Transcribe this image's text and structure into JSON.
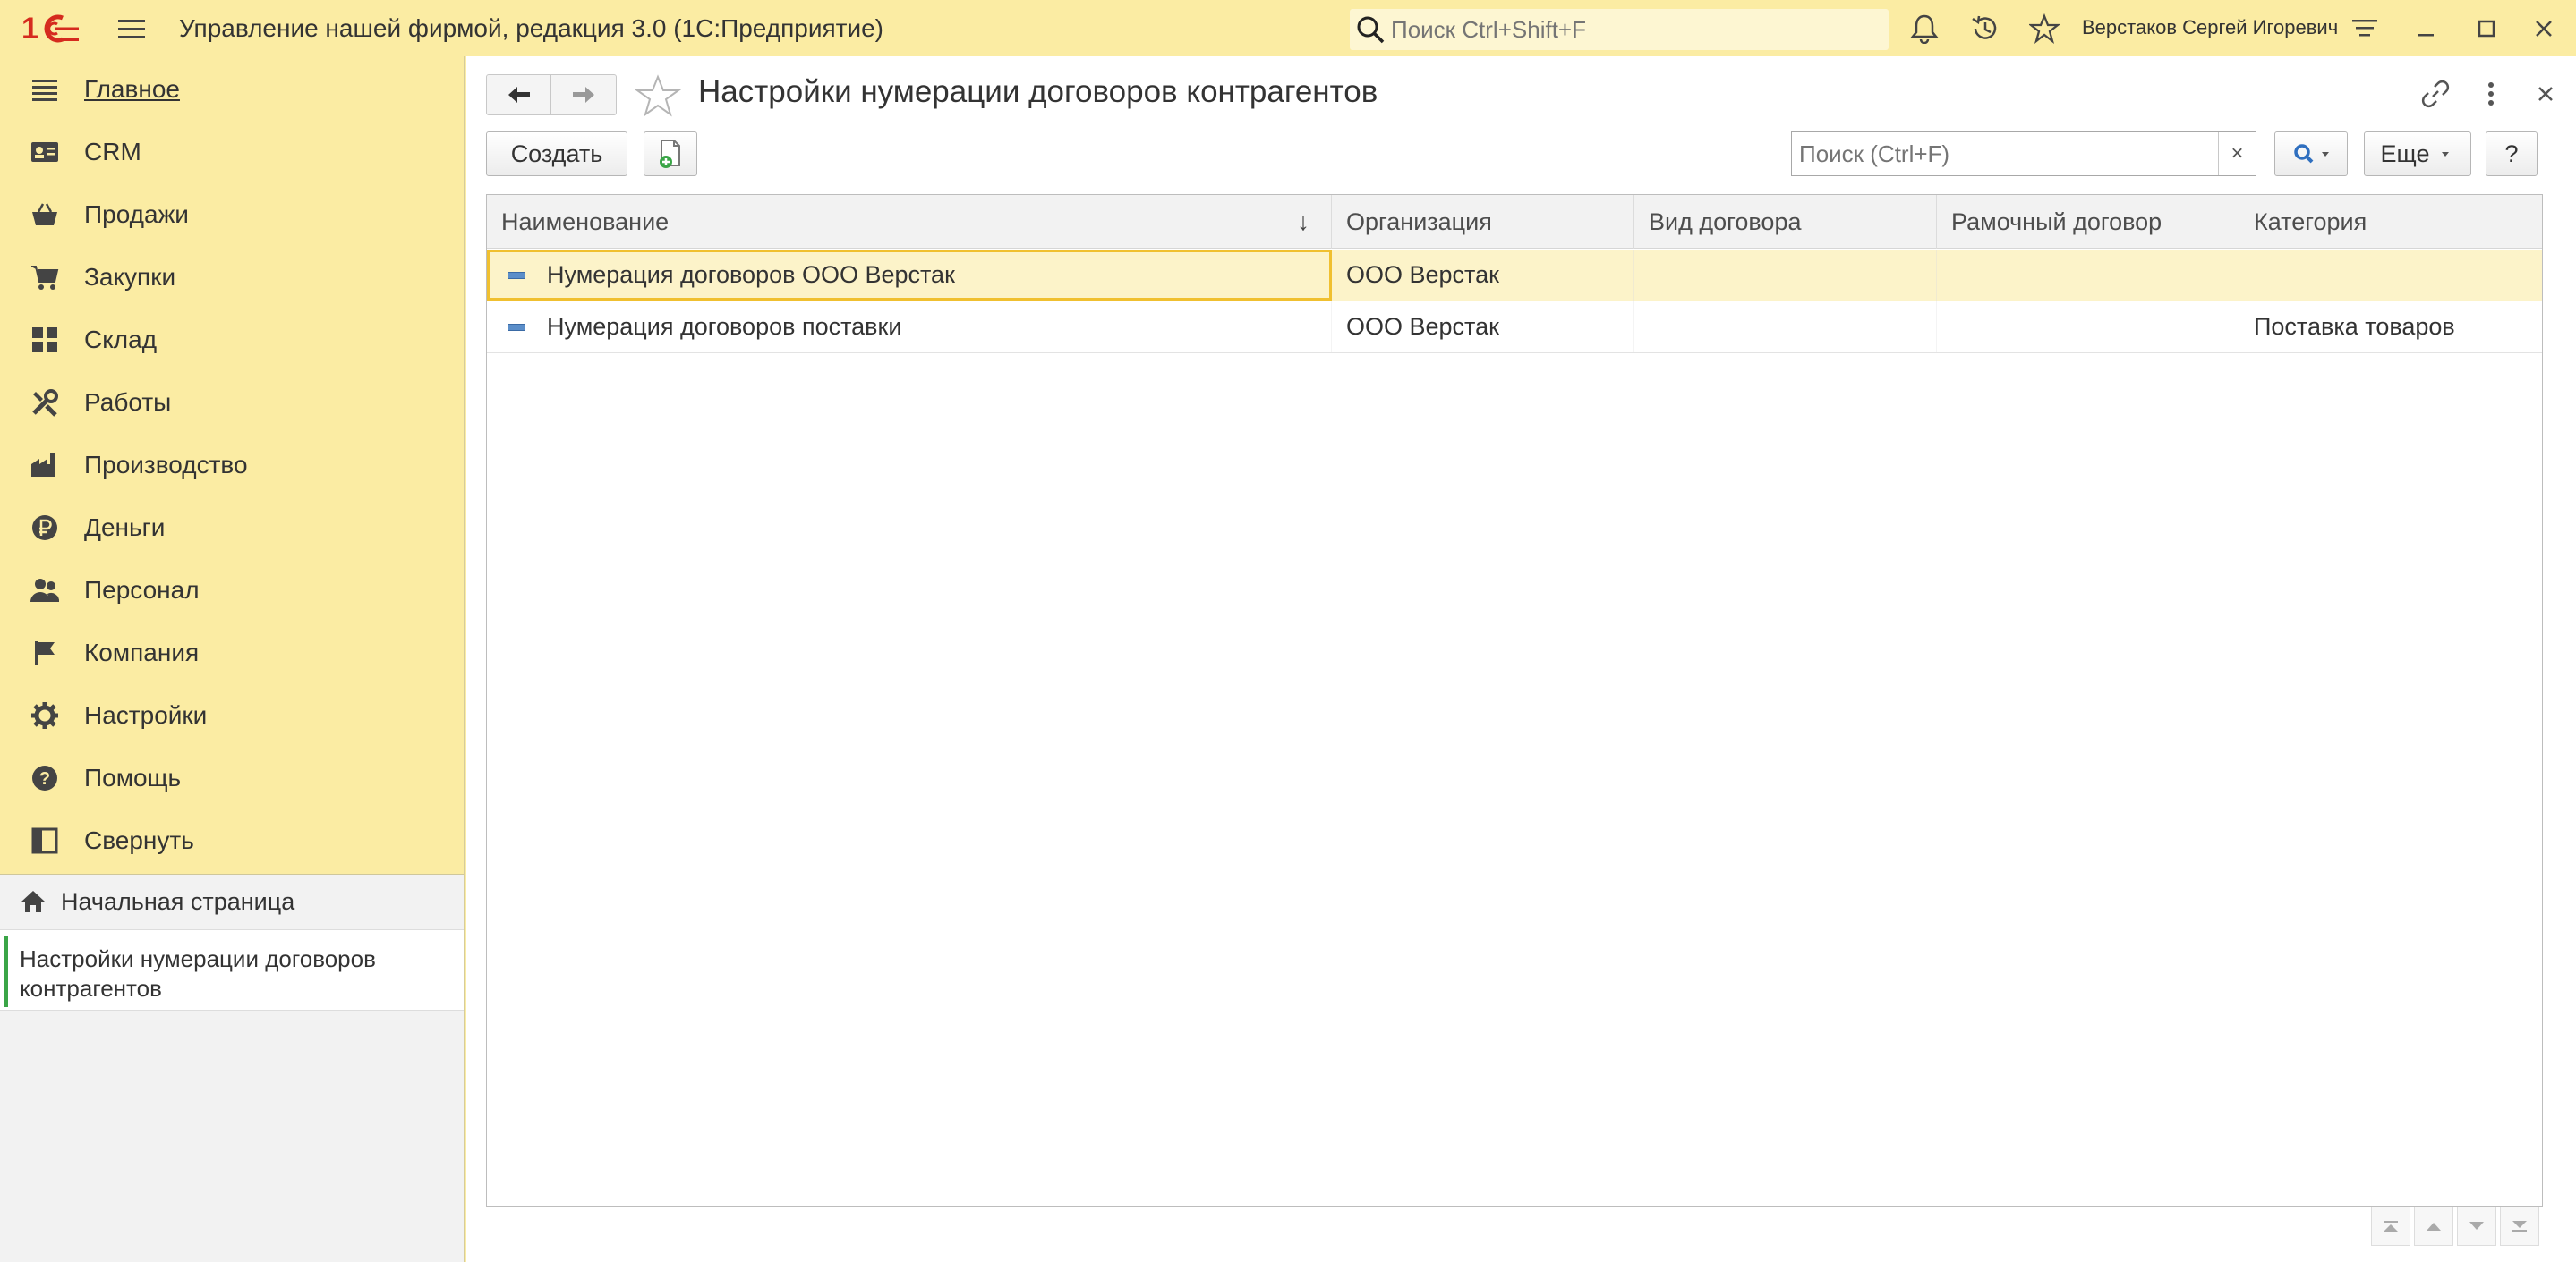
{
  "app": {
    "title": "Управление нашей фирмой, редакция 3.0  (1С:Предприятие)",
    "search_placeholder": "Поиск Ctrl+Shift+F",
    "user": "Верстаков Сергей Игоревич"
  },
  "sidebar": {
    "items": [
      {
        "label": "Главное",
        "icon": "list-icon"
      },
      {
        "label": "CRM",
        "icon": "contact-card-icon"
      },
      {
        "label": "Продажи",
        "icon": "basket-icon"
      },
      {
        "label": "Закупки",
        "icon": "cart-icon"
      },
      {
        "label": "Склад",
        "icon": "warehouse-icon"
      },
      {
        "label": "Работы",
        "icon": "tools-icon"
      },
      {
        "label": "Производство",
        "icon": "factory-icon"
      },
      {
        "label": "Деньги",
        "icon": "ruble-icon"
      },
      {
        "label": "Персонал",
        "icon": "people-icon"
      },
      {
        "label": "Компания",
        "icon": "flag-icon"
      },
      {
        "label": "Настройки",
        "icon": "gear-icon"
      },
      {
        "label": "Помощь",
        "icon": "help-icon"
      },
      {
        "label": "Свернуть",
        "icon": "collapse-icon"
      }
    ],
    "open_windows": {
      "home": "Начальная страница",
      "current": "Настройки нумерации договоров контрагентов"
    }
  },
  "form": {
    "title": "Настройки нумерации договоров контрагентов",
    "create_label": "Создать",
    "search_placeholder": "Поиск (Ctrl+F)",
    "clear_label": "×",
    "more_label": "Еще",
    "help_label": "?"
  },
  "table": {
    "columns": [
      "Наименование",
      "Организация",
      "Вид договора",
      "Рамочный договор",
      "Категория"
    ],
    "sort_indicator": "↓",
    "rows": [
      {
        "name": "Нумерация договоров ООО Верстак",
        "org": "ООО Верстак",
        "kind": "",
        "framework": "",
        "category": "",
        "selected": true
      },
      {
        "name": "Нумерация договоров поставки",
        "org": "ООО Верстак",
        "kind": "",
        "framework": "",
        "category": "Поставка товаров",
        "selected": false
      }
    ]
  },
  "colors": {
    "accent_yellow": "#fbeca3",
    "logo_red": "#d52b1e",
    "selected_row": "#fcf3c9",
    "focus_border": "#f0c030"
  }
}
